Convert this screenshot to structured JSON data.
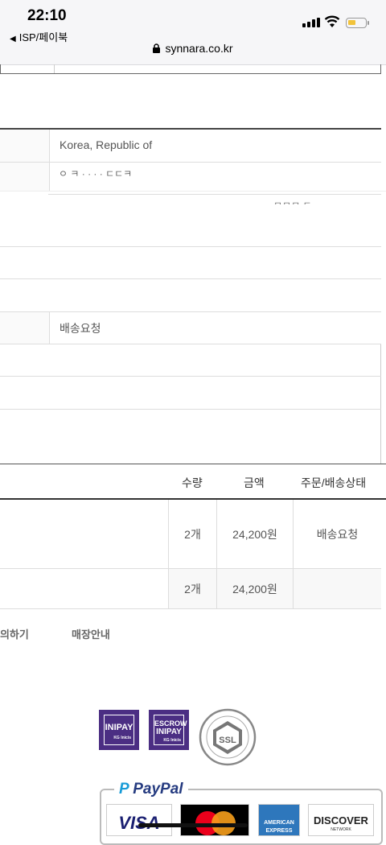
{
  "status_bar": {
    "time": "22:10",
    "back_label": "ISP/페이북",
    "url": "synnara.co.kr"
  },
  "form": {
    "country": "Korea, Republic of",
    "address_partial": "ㅇ ㅋ ·  ·  ·  ·  ㄷㄷㅋ",
    "address_suffix": "ㅁㅁㅁ ㄷ",
    "delivery_status": "배송요청"
  },
  "order_table": {
    "headers": {
      "qty": "수량",
      "amount": "금액",
      "status": "주문/배송상태"
    },
    "rows": [
      {
        "qty": "2개",
        "amount": "24,200원",
        "status": "배송요청"
      }
    ],
    "total": {
      "qty": "2개",
      "amount": "24,200원"
    }
  },
  "footer": {
    "link_inquiry": "문의하기",
    "link_store": "매장안내"
  },
  "badges": {
    "inipay": {
      "title": "INIPAY",
      "sub": "KG Inicis"
    },
    "escrow": {
      "line1": "ESCROW",
      "line2": "INIPAY",
      "sub": "KG Inicis"
    },
    "ssl": "SSL"
  },
  "payments": {
    "paypal": "PayPal",
    "visa": "VISA",
    "amex_line1": "AMERICAN",
    "amex_line2": "EXPRESS",
    "discover": "DISCOVER",
    "discover_sub": "NETWORK"
  },
  "colors": {
    "inipay_purple": "#4b2e83",
    "paypal_blue": "#253b80",
    "paypal_light": "#179bd7"
  }
}
